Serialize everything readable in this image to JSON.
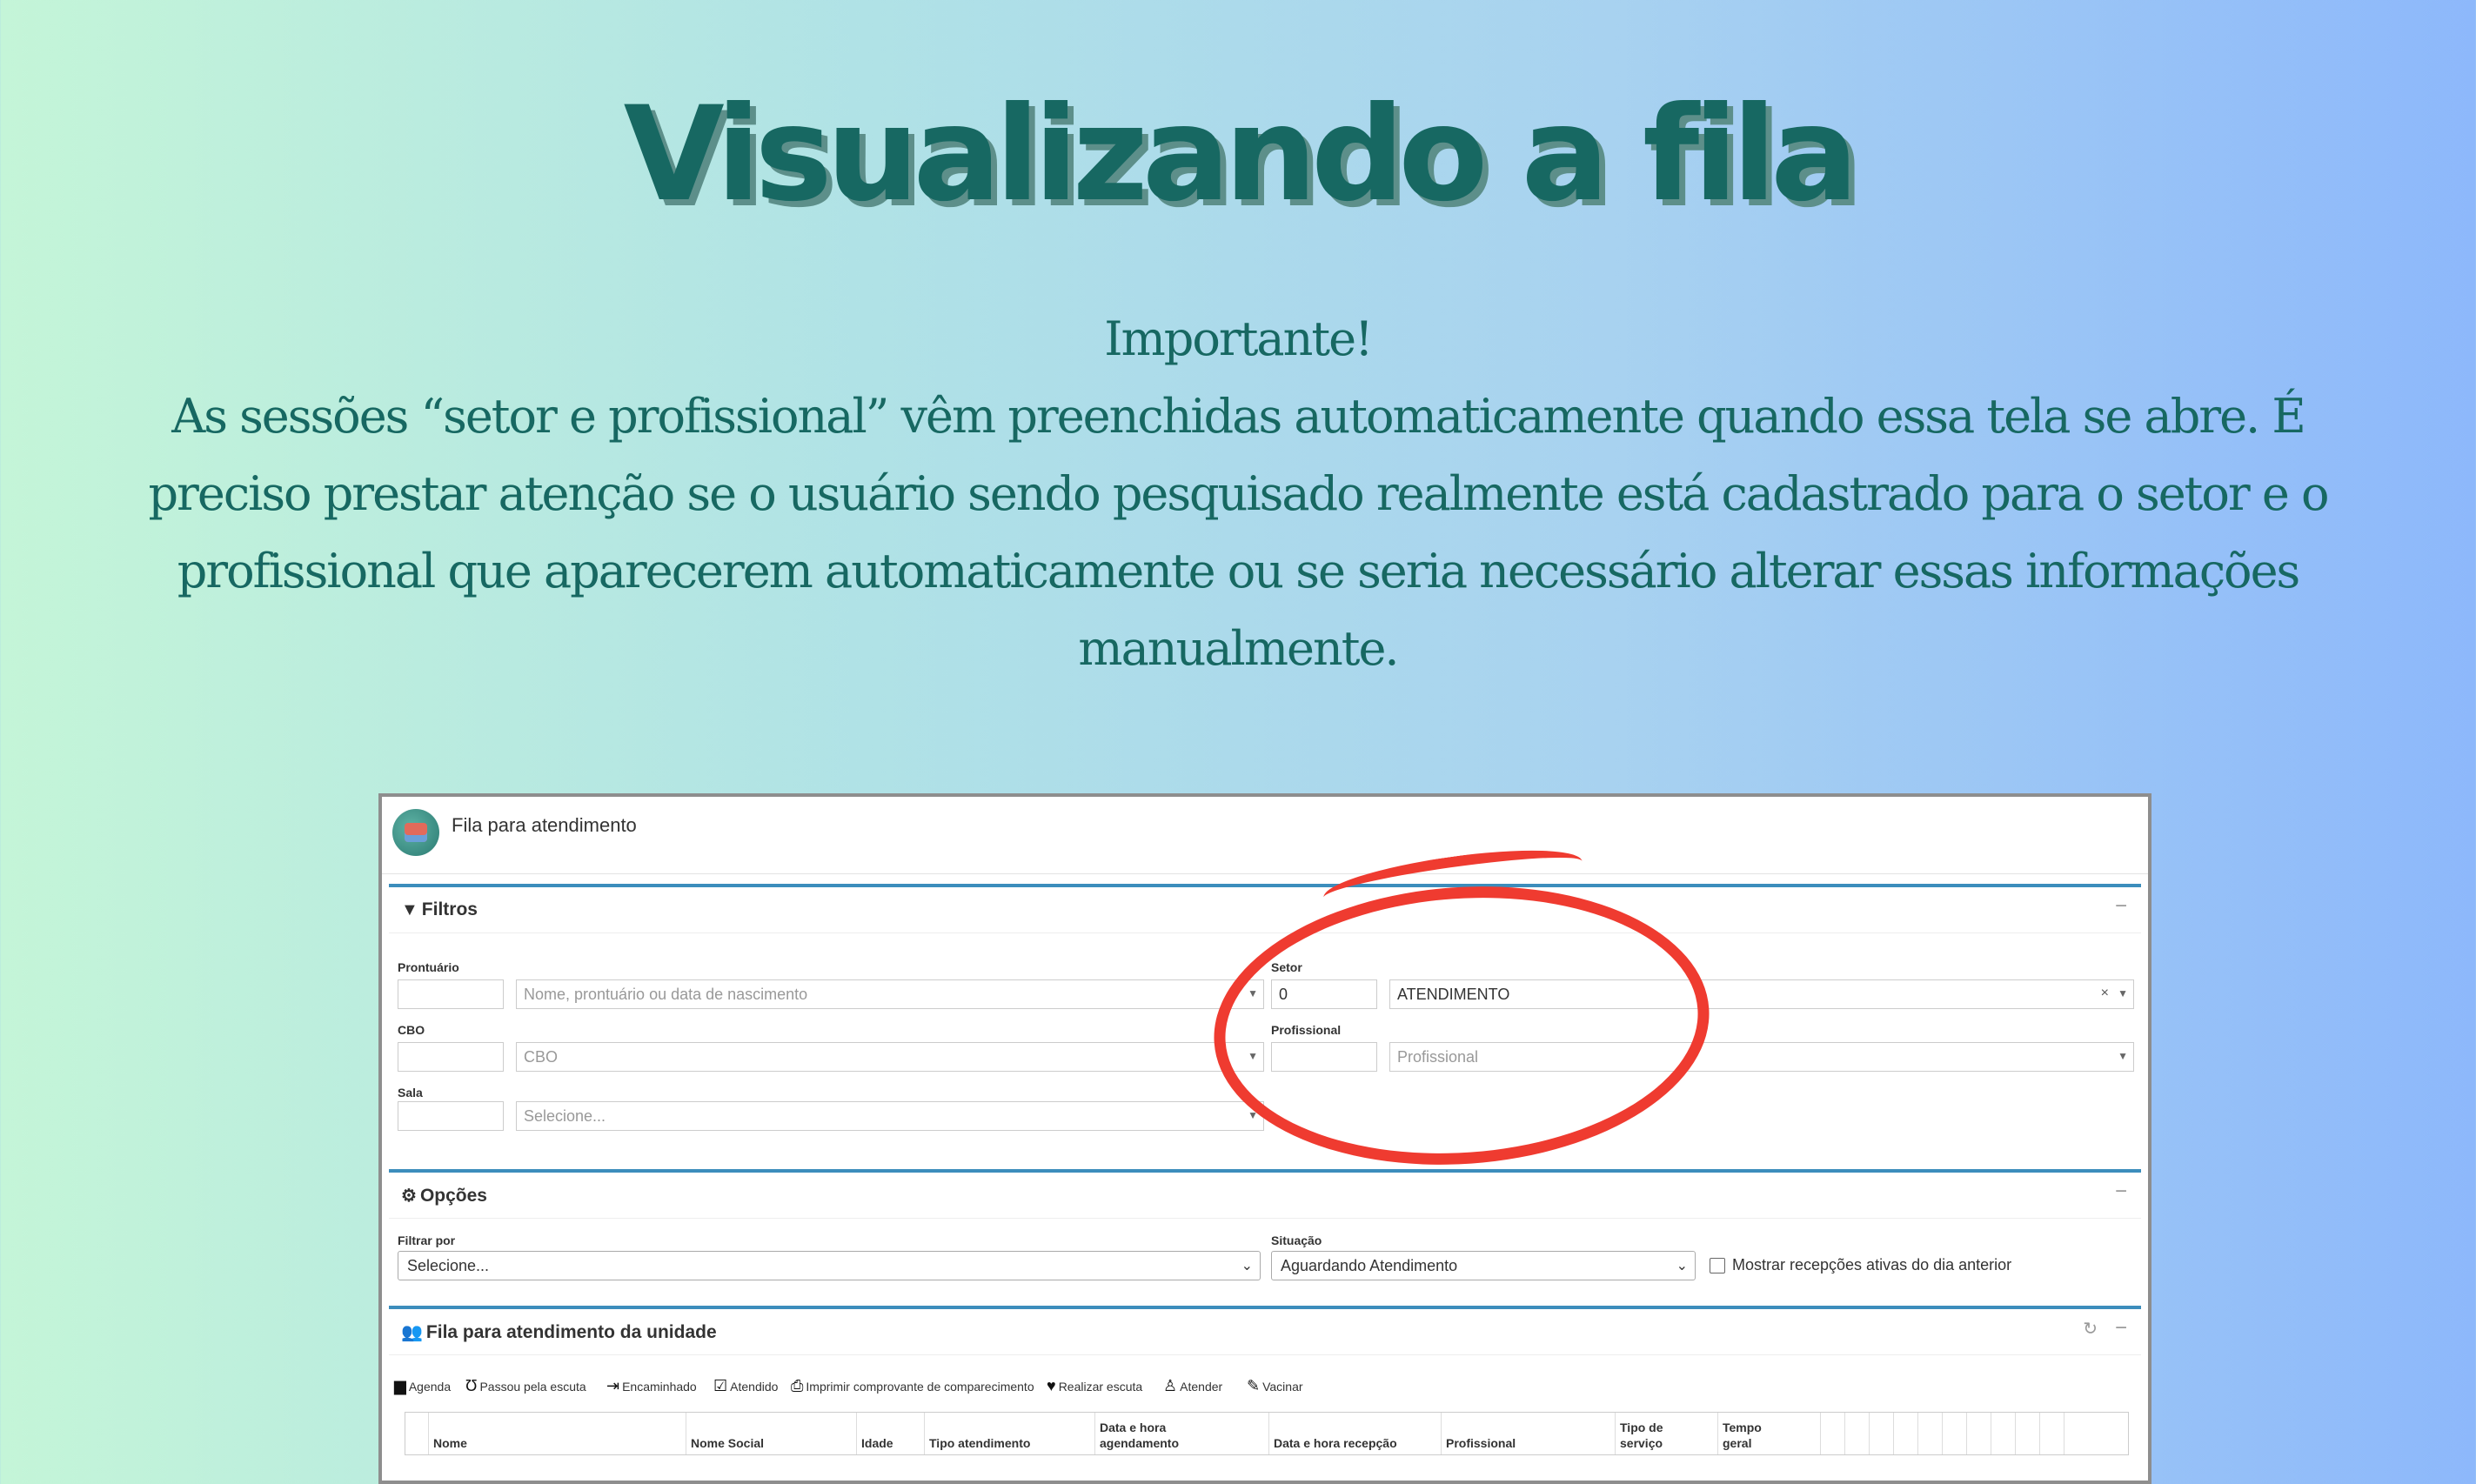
{
  "page": {
    "title": "Visualizando a fila",
    "intro_heading": "Importante!",
    "intro_lines": [
      "As sessões “setor e profissional” vêm preenchidas automaticamente quando essa tela se abre. É",
      "preciso prestar atenção se o usuário sendo pesquisado realmente está cadastrado para o setor e o",
      "profissional que aparecerem automaticamente ou se seria necessário alterar essas informações",
      "manualmente."
    ],
    "highlight_color": "#ef3b30"
  },
  "screen": {
    "title": "Fila para atendimento",
    "filters": {
      "title": "Filtros",
      "prontuario_label": "Prontuário",
      "prontuario_placeholder": "Nome, prontuário ou data de nascimento",
      "cbo_label": "CBO",
      "cbo_placeholder": "CBO",
      "sala_label": "Sala",
      "sala_placeholder": "Selecione...",
      "setor_label": "Setor",
      "setor_code": "0",
      "setor_value": "ATENDIMENTO",
      "profissional_label": "Profissional",
      "profissional_placeholder": "Profissional"
    },
    "options": {
      "title": "Opções",
      "filtrar_label": "Filtrar por",
      "filtrar_value": "Selecione...",
      "situacao_label": "Situação",
      "situacao_value": "Aguardando Atendimento",
      "checkbox_label": "Mostrar recepções ativas do dia anterior",
      "checkbox_checked": false
    },
    "queue": {
      "title": "Fila para atendimento da unidade",
      "tools": [
        "Agenda",
        "Passou pela escuta",
        "Encaminhado",
        "Atendido",
        "Imprimir comprovante de comparecimento",
        "Realizar escuta",
        "Atender",
        "Vacinar"
      ],
      "columns": [
        "Nome",
        "Nome Social",
        "Idade",
        "Tipo atendimento",
        "Data e hora agendamento",
        "Data e hora recepção",
        "Profissional",
        "Tipo de serviço",
        "Tempo geral"
      ]
    },
    "accent_color": "#3c8dbc"
  }
}
